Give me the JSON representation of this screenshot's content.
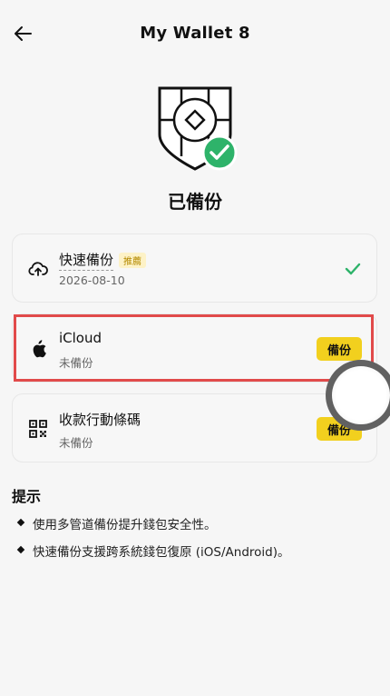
{
  "header": {
    "title": "My Wallet 8",
    "back_icon": "arrow-left-icon"
  },
  "status": {
    "label": "已備份",
    "icon": "shield-check-icon",
    "accent": "#2eb36a"
  },
  "step_marker": "4",
  "options": [
    {
      "name": "快速備份",
      "badge": "推薦",
      "subtitle": "2026-08-10",
      "icon": "cloud-upload-icon",
      "state": "done"
    },
    {
      "name": "iCloud",
      "subtitle": "未備份",
      "icon": "apple-icon",
      "button": "備份"
    },
    {
      "name": "收款行動條碼",
      "subtitle": "未備份",
      "icon": "qr-code-icon",
      "button": "備份"
    }
  ],
  "tips": {
    "title": "提示",
    "items": [
      "使用多管道備份提升錢包安全性。",
      "快速備份支援跨系統錢包復原 (iOS/Android)。"
    ]
  },
  "colors": {
    "button_bg": "#f2d01e",
    "highlight": "#e14a4a",
    "check": "#2eb36a"
  }
}
